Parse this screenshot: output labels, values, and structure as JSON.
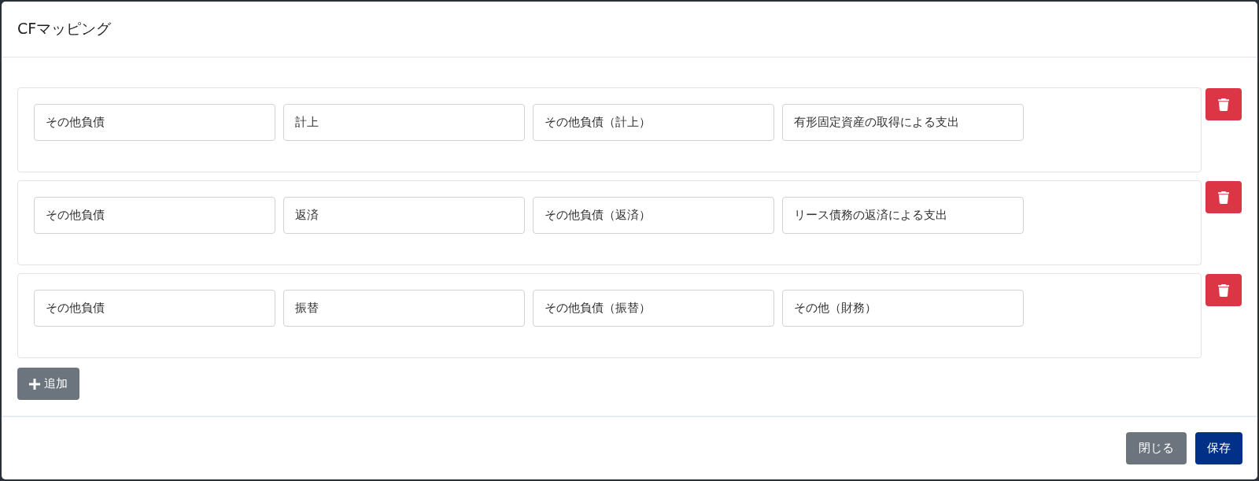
{
  "dialog": {
    "title": "CFマッピング"
  },
  "mappings": [
    {
      "fields": [
        "その他負債",
        "計上",
        "その他負債（計上）",
        "有形固定資産の取得による支出"
      ]
    },
    {
      "fields": [
        "その他負債",
        "返済",
        "その他負債（返済）",
        "リース債務の返済による支出"
      ]
    },
    {
      "fields": [
        "その他負債",
        "振替",
        "その他負債（振替）",
        "その他（財務）"
      ]
    }
  ],
  "add_button": {
    "label": "追加"
  },
  "footer_buttons": [
    {
      "label": "閉じる",
      "kind": "secondary"
    },
    {
      "label": "保存",
      "kind": "primary"
    }
  ]
}
